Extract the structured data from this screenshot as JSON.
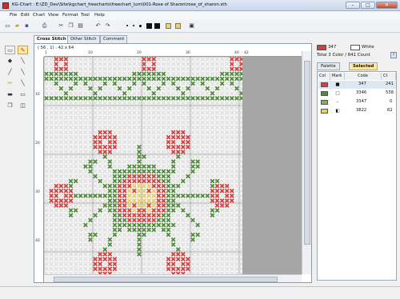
{
  "window": {
    "title": "KG-Chart : E:\\ZD_Dev\\Site\\kgchart_freecharts\\freechart_lum\\001-Rose of Sharon\\rose_of_sharon.sth"
  },
  "menu": [
    "File",
    "Edit",
    "Chart",
    "View",
    "Format",
    "Tool",
    "Help"
  ],
  "tabs": [
    "Cross Stitch",
    "Other Stitch",
    "Comment"
  ],
  "active_tab": "Cross Stitch",
  "coordinate_readout": "( 56 , 1)  : 42 x 64",
  "ruler_top": [
    "1",
    "10",
    "20",
    "30",
    "40",
    "42"
  ],
  "ruler_left": [
    "10",
    "20",
    "30",
    "40"
  ],
  "colors_palette": {
    "fabric": "#dcdcdc",
    "red": "#d23f3f",
    "green": "#4f8a3c",
    "yellow": "#e6cf6a"
  },
  "current_colors": {
    "primary_code": "347",
    "primary_color": "#d23f3f",
    "secondary_label": "White"
  },
  "total_summary": "Total 3 Color / 841 Count",
  "panel_tabs": [
    "Palette",
    "Selected"
  ],
  "active_panel_tab": "Selected",
  "color_table": {
    "headers": [
      "Col",
      "Mark",
      "Code",
      "Ct"
    ],
    "rows": [
      {
        "color": "#d23f3f",
        "mark": "square",
        "code": "347",
        "count": "241"
      },
      {
        "color": "#4f8a3c",
        "mark": "square-outline",
        "code": "3346",
        "count": "538"
      },
      {
        "color": "#8aa866",
        "mark": "dash",
        "code": "3347",
        "count": "0"
      },
      {
        "color": "#e6cf6a",
        "mark": "square-half",
        "code": "3822",
        "count": "62"
      }
    ]
  }
}
